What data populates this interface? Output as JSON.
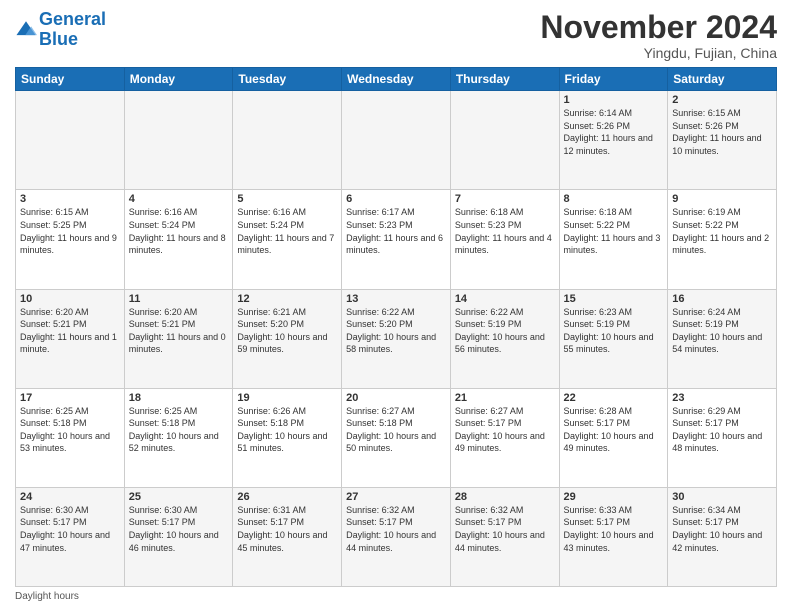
{
  "header": {
    "logo_line1": "General",
    "logo_line2": "Blue",
    "month_title": "November 2024",
    "location": "Yingdu, Fujian, China"
  },
  "days_of_week": [
    "Sunday",
    "Monday",
    "Tuesday",
    "Wednesday",
    "Thursday",
    "Friday",
    "Saturday"
  ],
  "footer": {
    "label": "Daylight hours"
  },
  "weeks": [
    [
      {
        "day": "",
        "info": ""
      },
      {
        "day": "",
        "info": ""
      },
      {
        "day": "",
        "info": ""
      },
      {
        "day": "",
        "info": ""
      },
      {
        "day": "",
        "info": ""
      },
      {
        "day": "1",
        "info": "Sunrise: 6:14 AM\nSunset: 5:26 PM\nDaylight: 11 hours and 12 minutes."
      },
      {
        "day": "2",
        "info": "Sunrise: 6:15 AM\nSunset: 5:26 PM\nDaylight: 11 hours and 10 minutes."
      }
    ],
    [
      {
        "day": "3",
        "info": "Sunrise: 6:15 AM\nSunset: 5:25 PM\nDaylight: 11 hours and 9 minutes."
      },
      {
        "day": "4",
        "info": "Sunrise: 6:16 AM\nSunset: 5:24 PM\nDaylight: 11 hours and 8 minutes."
      },
      {
        "day": "5",
        "info": "Sunrise: 6:16 AM\nSunset: 5:24 PM\nDaylight: 11 hours and 7 minutes."
      },
      {
        "day": "6",
        "info": "Sunrise: 6:17 AM\nSunset: 5:23 PM\nDaylight: 11 hours and 6 minutes."
      },
      {
        "day": "7",
        "info": "Sunrise: 6:18 AM\nSunset: 5:23 PM\nDaylight: 11 hours and 4 minutes."
      },
      {
        "day": "8",
        "info": "Sunrise: 6:18 AM\nSunset: 5:22 PM\nDaylight: 11 hours and 3 minutes."
      },
      {
        "day": "9",
        "info": "Sunrise: 6:19 AM\nSunset: 5:22 PM\nDaylight: 11 hours and 2 minutes."
      }
    ],
    [
      {
        "day": "10",
        "info": "Sunrise: 6:20 AM\nSunset: 5:21 PM\nDaylight: 11 hours and 1 minute."
      },
      {
        "day": "11",
        "info": "Sunrise: 6:20 AM\nSunset: 5:21 PM\nDaylight: 11 hours and 0 minutes."
      },
      {
        "day": "12",
        "info": "Sunrise: 6:21 AM\nSunset: 5:20 PM\nDaylight: 10 hours and 59 minutes."
      },
      {
        "day": "13",
        "info": "Sunrise: 6:22 AM\nSunset: 5:20 PM\nDaylight: 10 hours and 58 minutes."
      },
      {
        "day": "14",
        "info": "Sunrise: 6:22 AM\nSunset: 5:19 PM\nDaylight: 10 hours and 56 minutes."
      },
      {
        "day": "15",
        "info": "Sunrise: 6:23 AM\nSunset: 5:19 PM\nDaylight: 10 hours and 55 minutes."
      },
      {
        "day": "16",
        "info": "Sunrise: 6:24 AM\nSunset: 5:19 PM\nDaylight: 10 hours and 54 minutes."
      }
    ],
    [
      {
        "day": "17",
        "info": "Sunrise: 6:25 AM\nSunset: 5:18 PM\nDaylight: 10 hours and 53 minutes."
      },
      {
        "day": "18",
        "info": "Sunrise: 6:25 AM\nSunset: 5:18 PM\nDaylight: 10 hours and 52 minutes."
      },
      {
        "day": "19",
        "info": "Sunrise: 6:26 AM\nSunset: 5:18 PM\nDaylight: 10 hours and 51 minutes."
      },
      {
        "day": "20",
        "info": "Sunrise: 6:27 AM\nSunset: 5:18 PM\nDaylight: 10 hours and 50 minutes."
      },
      {
        "day": "21",
        "info": "Sunrise: 6:27 AM\nSunset: 5:17 PM\nDaylight: 10 hours and 49 minutes."
      },
      {
        "day": "22",
        "info": "Sunrise: 6:28 AM\nSunset: 5:17 PM\nDaylight: 10 hours and 49 minutes."
      },
      {
        "day": "23",
        "info": "Sunrise: 6:29 AM\nSunset: 5:17 PM\nDaylight: 10 hours and 48 minutes."
      }
    ],
    [
      {
        "day": "24",
        "info": "Sunrise: 6:30 AM\nSunset: 5:17 PM\nDaylight: 10 hours and 47 minutes."
      },
      {
        "day": "25",
        "info": "Sunrise: 6:30 AM\nSunset: 5:17 PM\nDaylight: 10 hours and 46 minutes."
      },
      {
        "day": "26",
        "info": "Sunrise: 6:31 AM\nSunset: 5:17 PM\nDaylight: 10 hours and 45 minutes."
      },
      {
        "day": "27",
        "info": "Sunrise: 6:32 AM\nSunset: 5:17 PM\nDaylight: 10 hours and 44 minutes."
      },
      {
        "day": "28",
        "info": "Sunrise: 6:32 AM\nSunset: 5:17 PM\nDaylight: 10 hours and 44 minutes."
      },
      {
        "day": "29",
        "info": "Sunrise: 6:33 AM\nSunset: 5:17 PM\nDaylight: 10 hours and 43 minutes."
      },
      {
        "day": "30",
        "info": "Sunrise: 6:34 AM\nSunset: 5:17 PM\nDaylight: 10 hours and 42 minutes."
      }
    ]
  ]
}
